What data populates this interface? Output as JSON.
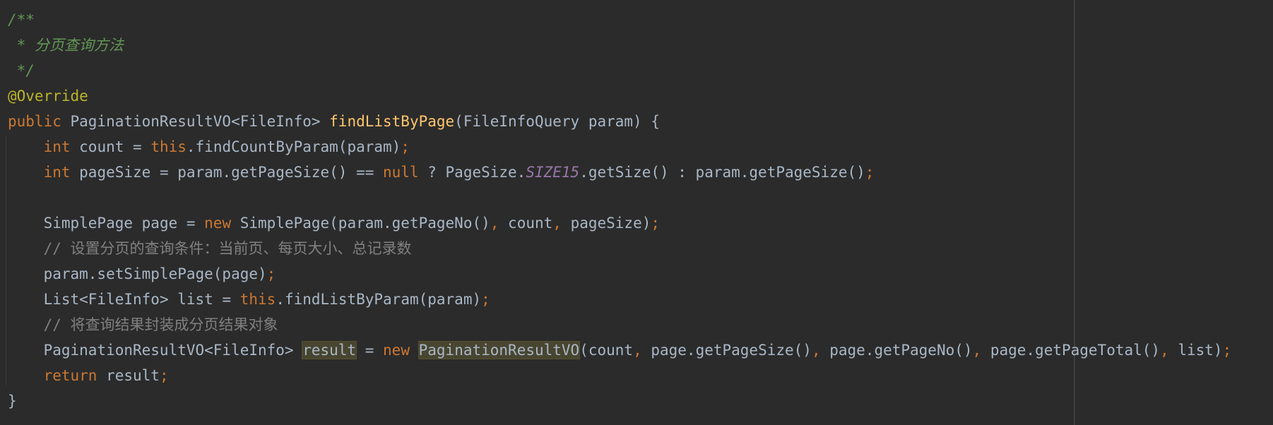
{
  "code": {
    "line1": "/**",
    "line2": " * 分页查询方法",
    "line3": " */",
    "line4": "@Override",
    "line5": {
      "kw_public": "public",
      "ret_type": " PaginationResultVO<FileInfo> ",
      "method": "findListByPage",
      "params": "(FileInfoQuery param) {"
    },
    "line6": {
      "indent": "    ",
      "kw_int": "int",
      "t1": " count = ",
      "kw_this": "this",
      "t2": ".findCountByParam(param)",
      "semi": ";"
    },
    "line7": {
      "indent": "    ",
      "kw_int": "int",
      "t1": " pageSize = param.getPageSize() == ",
      "kw_null": "null",
      "t2": " ? PageSize.",
      "const": "SIZE15",
      "t3": ".getSize() : param.getPageSize()",
      "semi": ";"
    },
    "line8": "",
    "line9": {
      "indent": "    ",
      "t1": "SimplePage page = ",
      "kw_new": "new",
      "t2": " SimplePage(param.getPageNo()",
      "c1": ",",
      "t3": " count",
      "c2": ",",
      "t4": " pageSize)",
      "semi": ";"
    },
    "line10": "    // 设置分页的查询条件：当前页、每页大小、总记录数",
    "line11": {
      "t1": "    param.setSimplePage(page)",
      "semi": ";"
    },
    "line12": {
      "indent": "    ",
      "t1": "List<FileInfo> list = ",
      "kw_this": "this",
      "t2": ".findListByParam(param)",
      "semi": ";"
    },
    "line13": "    // 将查询结果封装成分页结果对象",
    "line14": {
      "t1": "    PaginationResultVO<FileInfo> ",
      "var_result": "result",
      "t2": " = ",
      "kw_new": "new",
      "sp": " ",
      "ctor": "PaginationResultVO",
      "t3": "(count",
      "c1": ",",
      "t4": " page.getPageSize()",
      "c2": ",",
      "t5": " page.getPageNo()",
      "c3": ",",
      "t6": " page.getPageTotal()",
      "c4": ",",
      "t7": " list)",
      "semi": ";"
    },
    "line15": {
      "indent": "    ",
      "kw_return": "return",
      "t1": " result",
      "semi": ";"
    },
    "line16": "}"
  },
  "colors": {
    "background": "#2b2b2b",
    "text": "#a9b7c6",
    "keyword": "#cc7832",
    "method_decl": "#ffc66d",
    "annotation": "#bbb529",
    "doc_comment": "#629755",
    "line_comment": "#808080",
    "static_const": "#9876aa",
    "usage_highlight": "#484530"
  }
}
